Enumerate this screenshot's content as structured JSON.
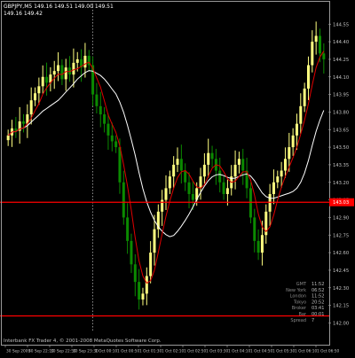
{
  "header": {
    "symbol_line": "GBPJPY,M5  149.16 149.51 149.00 149.51",
    "sub_line": "149.16 149.42"
  },
  "footer": {
    "copyright": "Interbank FX Trader 4, © 2001-2008 MetaQuotes Software Corp."
  },
  "clock_panel": {
    "rows": [
      {
        "label": "GMT",
        "value": "11:52"
      },
      {
        "label": "New York",
        "value": "06:52"
      },
      {
        "label": "London",
        "value": "11:52"
      },
      {
        "label": "Tokyo",
        "value": "20:52"
      },
      {
        "label": "Broker",
        "value": "03:41"
      },
      {
        "label": "Bar",
        "value": "00:01"
      },
      {
        "label": "Spread",
        "value": "7"
      }
    ]
  },
  "price_label": "143.03",
  "colors": {
    "background": "#000000",
    "bull_candle": "#ffff80",
    "bear_candle": "#0b8a00",
    "ma_fast": "#e00000",
    "ma_slow": "#ffffff",
    "hline": "#ff0000",
    "axis_text": "#c0c0c0",
    "price_tag_bg": "#ff0000"
  },
  "chart_data": {
    "type": "candlestick",
    "y_ticks": [
      "144.55",
      "144.40",
      "144.25",
      "144.10",
      "143.95",
      "143.80",
      "143.65",
      "143.50",
      "143.35",
      "143.20",
      "143.05",
      "142.90",
      "142.75",
      "142.60",
      "142.45",
      "142.30",
      "142.15",
      "142.00"
    ],
    "y_range": [
      141.92,
      144.62
    ],
    "x_ticks": [
      "30 Sep 2009",
      "30 Sep 22:10",
      "30 Sep 22:50",
      "30 Sep 23:30",
      "1 Oct 00:10",
      "1 Oct 00:50",
      "1 Oct 01:30",
      "1 Oct 02:10",
      "1 Oct 02:50",
      "1 Oct 03:30",
      "1 Oct 04:10",
      "1 Oct 04:50",
      "1 Oct 05:30",
      "1 Oct 06:10",
      "1 Oct 06:50"
    ],
    "horizontal_lines": [
      143.03,
      142.06
    ],
    "separator_index": 22,
    "ma_fast_name": "",
    "ma_slow_name": "",
    "close": [
      143.6,
      143.66,
      143.64,
      143.72,
      143.7,
      143.78,
      143.9,
      143.96,
      144.02,
      144.1,
      144.05,
      144.12,
      144.15,
      144.2,
      144.08,
      144.18,
      144.12,
      144.22,
      144.25,
      144.18,
      144.28,
      144.2,
      143.95,
      143.85,
      143.78,
      143.7,
      143.6,
      143.55,
      143.5,
      143.2,
      142.9,
      142.7,
      142.5,
      142.35,
      142.2,
      142.25,
      142.4,
      142.6,
      142.8,
      142.95,
      143.05,
      143.15,
      143.25,
      143.35,
      143.4,
      143.3,
      143.2,
      143.1,
      143.05,
      143.15,
      143.25,
      143.35,
      143.45,
      143.4,
      143.3,
      143.2,
      143.1,
      143.15,
      143.25,
      143.35,
      143.4,
      143.3,
      143.15,
      142.9,
      142.7,
      142.6,
      142.75,
      142.95,
      143.1,
      143.2,
      143.25,
      143.3,
      143.4,
      143.5,
      143.6,
      143.7,
      143.85,
      144.0,
      144.2,
      144.4,
      144.45,
      144.3,
      144.25
    ]
  }
}
